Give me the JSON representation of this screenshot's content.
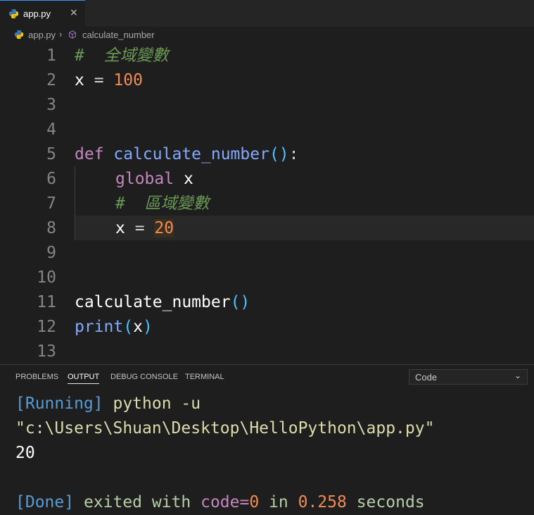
{
  "tab": {
    "label": "app.py",
    "close": "×"
  },
  "breadcrumb": {
    "file": "app.py",
    "separator": "›",
    "symbol": "calculate_number"
  },
  "editor": {
    "line_numbers": [
      "1",
      "2",
      "3",
      "4",
      "5",
      "6",
      "7",
      "8",
      "9",
      "10",
      "11",
      "12",
      "13"
    ],
    "code": {
      "l1_comment": "#  全域變數",
      "l2_var": "x",
      "l2_op": " = ",
      "l2_num": "100",
      "l5_kw": "def",
      "l5_fn": " calculate_number",
      "l5_paren": "()",
      "l5_colon": ":",
      "l6_kw": "global",
      "l6_var": " x",
      "l7_comment": "#  區域變數",
      "l8_var": "x",
      "l8_op": " = ",
      "l8_num": "20",
      "l11_fn": "calculate_number",
      "l11_paren": "()",
      "l12_fn": "print",
      "l12_open": "(",
      "l12_var": "x",
      "l12_close": ")"
    }
  },
  "panel": {
    "tabs": [
      "PROBLEMS",
      "OUTPUT",
      "DEBUG CONSOLE",
      "TERMINAL"
    ],
    "active_tab": "OUTPUT",
    "select_value": "Code",
    "output": {
      "running": "[Running]",
      "cmd": " python -u",
      "path": "\"c:\\Users\\Shuan\\Desktop\\HelloPython\\app.py\"",
      "result": "20",
      "done": "[Done]",
      "exited": " exited with ",
      "code": "code",
      "eq": "=",
      "code_val": "0",
      "in": " in ",
      "time": "0.258",
      "seconds": " seconds"
    }
  },
  "colors": {
    "accent": "#3794ff",
    "background": "#1e1e1e"
  }
}
